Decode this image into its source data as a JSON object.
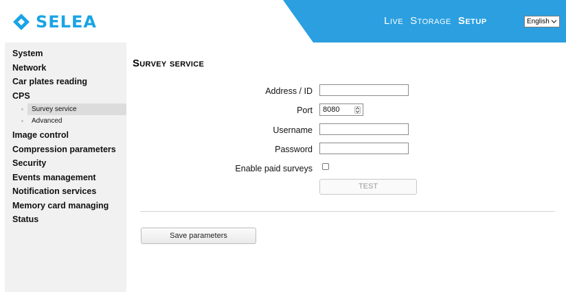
{
  "brand": {
    "name": "SELEA",
    "color": "#1aa3e6",
    "accent": "#2b9fe0"
  },
  "topnav": {
    "live": "Live",
    "storage": "Storage",
    "setup": "Setup",
    "active": "setup"
  },
  "language": {
    "selected": "English"
  },
  "sidebar": {
    "items": [
      {
        "label": "System"
      },
      {
        "label": "Network"
      },
      {
        "label": "Car plates reading"
      },
      {
        "label": "CPS",
        "children": [
          {
            "label": "Survey service",
            "active": true
          },
          {
            "label": "Advanced"
          }
        ]
      },
      {
        "label": "Image control"
      },
      {
        "label": "Compression parameters"
      },
      {
        "label": "Security"
      },
      {
        "label": "Events management"
      },
      {
        "label": "Notification services"
      },
      {
        "label": "Memory card managing"
      },
      {
        "label": "Status"
      }
    ],
    "bullet": "◦"
  },
  "main": {
    "title": "Survey service",
    "fields": {
      "address": {
        "label": "Address / ID",
        "value": ""
      },
      "port": {
        "label": "Port",
        "value": "8080"
      },
      "username": {
        "label": "Username",
        "value": ""
      },
      "password": {
        "label": "Password",
        "value": ""
      },
      "paid": {
        "label": "Enable paid surveys",
        "checked": false
      }
    },
    "test_label": "TEST",
    "save_label": "Save parameters"
  }
}
